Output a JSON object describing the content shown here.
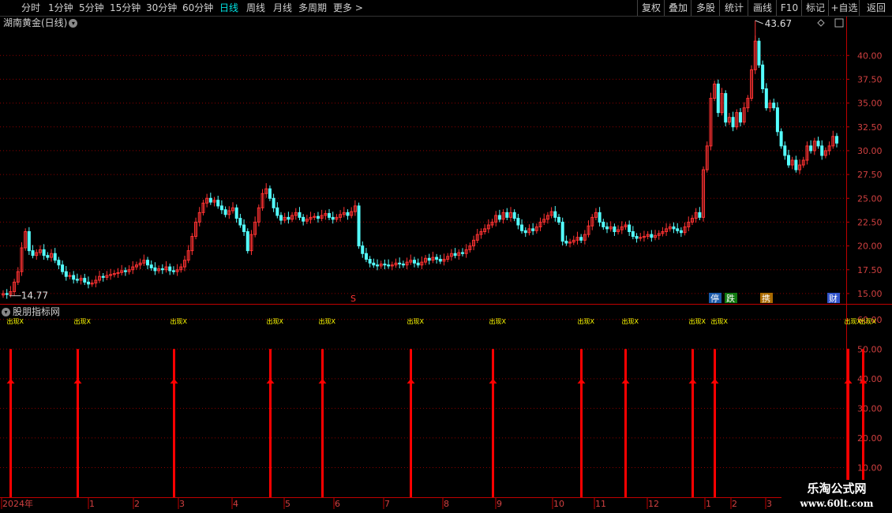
{
  "toolbar": {
    "periods": [
      {
        "label": "分时",
        "active": false
      },
      {
        "label": "1分钟",
        "active": false
      },
      {
        "label": "5分钟",
        "active": false
      },
      {
        "label": "15分钟",
        "active": false
      },
      {
        "label": "30分钟",
        "active": false
      },
      {
        "label": "60分钟",
        "active": false
      },
      {
        "label": "日线",
        "active": true
      },
      {
        "label": "周线",
        "active": false
      },
      {
        "label": "月线",
        "active": false
      },
      {
        "label": "多周期",
        "active": false
      },
      {
        "label": "更多 >",
        "active": false
      }
    ],
    "actions": [
      "复权",
      "叠加",
      "多股",
      "统计",
      "画线",
      "F10",
      "标记",
      "+自选",
      "返回"
    ]
  },
  "main_chart": {
    "title": "湖南黄金(日线)",
    "high_label": "43.67",
    "low_label": "14.77",
    "y_ticks": [
      "40.00",
      "37.50",
      "35.00",
      "32.50",
      "30.00",
      "27.50",
      "25.00",
      "22.50",
      "20.00",
      "17.50",
      "15.00"
    ],
    "markers": [
      "S",
      "停",
      "跌",
      "携",
      "财"
    ]
  },
  "indicator": {
    "title": "股朋指标网",
    "signal_label": "出现X",
    "y_ticks": [
      "60.00",
      "50.00",
      "40.00",
      "30.00",
      "20.00",
      "10.00"
    ]
  },
  "x_axis": {
    "labels": [
      "2024年",
      "1",
      "2",
      "3",
      "4",
      "5",
      "6",
      "7",
      "8",
      "9",
      "10",
      "11",
      "12",
      "1",
      "2",
      "3"
    ]
  },
  "watermark": {
    "title": "乐淘公式网",
    "url": "www.60lt.com"
  },
  "colors": {
    "up": "#ff3232",
    "down": "#54ffff",
    "grid": "#8b0000",
    "signal": "#ff0000",
    "label": "#ffff00",
    "axis": "#c00000"
  },
  "chart_data": {
    "type": "candlestick",
    "series": [
      {
        "name": "close",
        "values": [
          15.0,
          14.9,
          15.2,
          16.2,
          17.3,
          19.8,
          21.5,
          19.5,
          19.0,
          19.3,
          19.6,
          19.0,
          18.8,
          19.2,
          18.5,
          18.0,
          17.3,
          16.8,
          16.9,
          16.5,
          16.4,
          16.6,
          16.2,
          16.0,
          16.1,
          16.4,
          16.8,
          16.7,
          16.9,
          17.0,
          17.1,
          17.2,
          17.4,
          17.3,
          17.5,
          17.8,
          18.0,
          18.2,
          18.5,
          18.0,
          17.7,
          17.4,
          17.6,
          17.5,
          17.8,
          17.4,
          17.3,
          17.5,
          17.8,
          18.5,
          19.5,
          21.0,
          22.5,
          23.5,
          24.5,
          25.0,
          24.6,
          24.8,
          24.2,
          23.8,
          23.3,
          23.7,
          24.0,
          22.9,
          22.2,
          21.5,
          19.5,
          21.2,
          22.5,
          24.0,
          25.5,
          26.0,
          25.0,
          24.0,
          23.2,
          22.7,
          23.0,
          22.8,
          23.2,
          23.5,
          23.0,
          22.6,
          22.8,
          23.0,
          23.1,
          22.9,
          23.2,
          23.4,
          23.0,
          22.8,
          23.0,
          23.3,
          23.5,
          23.2,
          23.6,
          24.2,
          20.0,
          19.2,
          18.6,
          18.2,
          18.0,
          17.9,
          18.1,
          18.0,
          17.9,
          18.0,
          18.2,
          18.1,
          18.0,
          18.3,
          18.5,
          18.2,
          18.0,
          18.3,
          18.7,
          18.5,
          18.8,
          18.6,
          18.4,
          18.6,
          18.9,
          19.2,
          19.0,
          19.3,
          19.2,
          19.6,
          20.0,
          20.6,
          21.2,
          21.5,
          21.8,
          22.2,
          22.5,
          23.2,
          22.8,
          23.5,
          23.0,
          23.5,
          22.9,
          22.2,
          21.6,
          21.4,
          21.8,
          21.6,
          22.0,
          22.5,
          22.8,
          23.2,
          23.6,
          23.0,
          22.5,
          20.5,
          20.3,
          20.4,
          20.6,
          20.9,
          20.6,
          21.2,
          22.1,
          23.0,
          23.5,
          22.5,
          22.0,
          21.8,
          22.0,
          21.5,
          21.7,
          22.0,
          22.2,
          21.5,
          21.0,
          20.8,
          20.9,
          21.0,
          21.2,
          20.9,
          21.1,
          21.3,
          21.5,
          21.8,
          22.0,
          21.8,
          21.6,
          21.4,
          22.0,
          22.5,
          22.9,
          23.5,
          23.0,
          28.0,
          30.5,
          35.5,
          37.0,
          34.0,
          36.0,
          33.0,
          33.5,
          32.5,
          34.0,
          33.0,
          34.5,
          35.5,
          38.5,
          41.5,
          39.0,
          36.5,
          34.5,
          35.0,
          34.5,
          32.0,
          30.5,
          29.5,
          28.5,
          29.0,
          28.0,
          28.5,
          29.0,
          30.5,
          30.0,
          31.0,
          30.5,
          29.5,
          30.0,
          30.5,
          31.5,
          30.8
        ]
      },
      {
        "name": "signal",
        "values": [
          50,
          50,
          50,
          50,
          50,
          50,
          50,
          50,
          50,
          50,
          50,
          50,
          50
        ]
      }
    ],
    "ylim": [
      14,
      44
    ],
    "indicator_ylim": [
      0,
      65
    ],
    "max": 43.67,
    "min": 14.77,
    "signal_columns": [
      1,
      10,
      23,
      36,
      43,
      55,
      66,
      78,
      84,
      93,
      96,
      114,
      116
    ]
  }
}
